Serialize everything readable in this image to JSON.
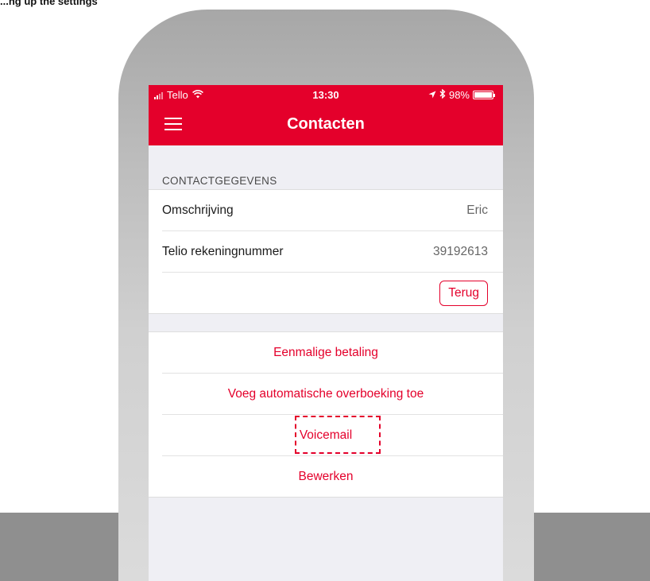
{
  "caption": "...ng up the settings",
  "status_bar": {
    "carrier": "Tello",
    "time": "13:30",
    "battery": "98%",
    "battery_level": 0.98
  },
  "nav": {
    "title": "Contacten",
    "menu_icon": "hamburger-icon"
  },
  "contact": {
    "section_label": "CONTACTGEGEVENS",
    "rows": [
      {
        "label": "Omschrijving",
        "value": "Eric"
      },
      {
        "label": "Telio rekeningnummer",
        "value": "39192613"
      }
    ],
    "back_button": "Terug"
  },
  "actions": [
    {
      "label": "Eenmalige betaling"
    },
    {
      "label": "Voeg automatische overboeking toe"
    },
    {
      "label": "Voicemail",
      "highlighted": true
    },
    {
      "label": "Bewerken"
    }
  ],
  "colors": {
    "brand_red": "#e4002b",
    "background": "#efeff4"
  }
}
